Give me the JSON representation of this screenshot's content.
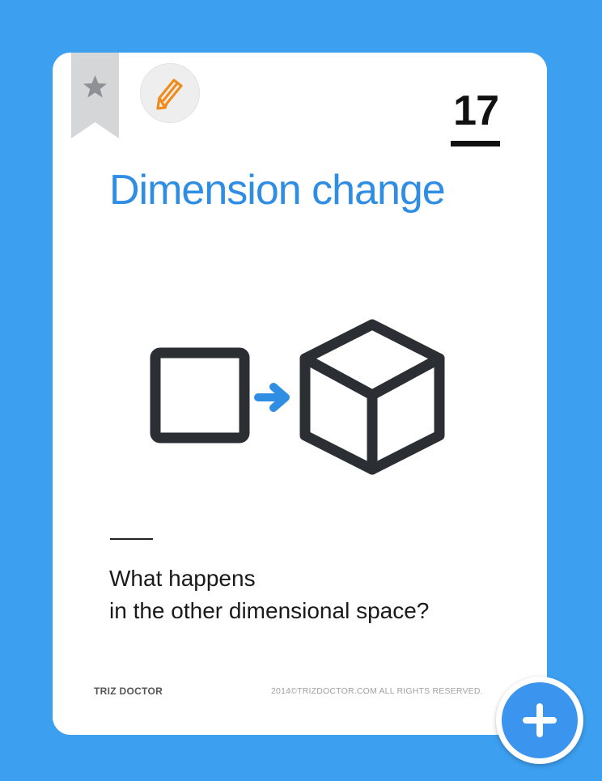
{
  "card": {
    "number": "17",
    "title": "Dimension change",
    "question_line1": "What happens",
    "question_line2": "in the other dimensional space?",
    "brand": "TRIZ DOCTOR",
    "copyright": "2014©TRIZDOCTOR.COM  ALL RIGHTS RESERVED."
  },
  "icons": {
    "bookmark": "star-bookmark-icon",
    "edit": "pencil-icon",
    "add": "plus-icon",
    "illustration": [
      "square-icon",
      "arrow-right-icon",
      "cube-icon"
    ]
  },
  "colors": {
    "background": "#3d9ff0",
    "title": "#2f8ee4",
    "pencil": "#f08c1e",
    "add_button": "#3b95ee",
    "illustration": "#2b2f33",
    "arrow": "#2f8ee4"
  }
}
